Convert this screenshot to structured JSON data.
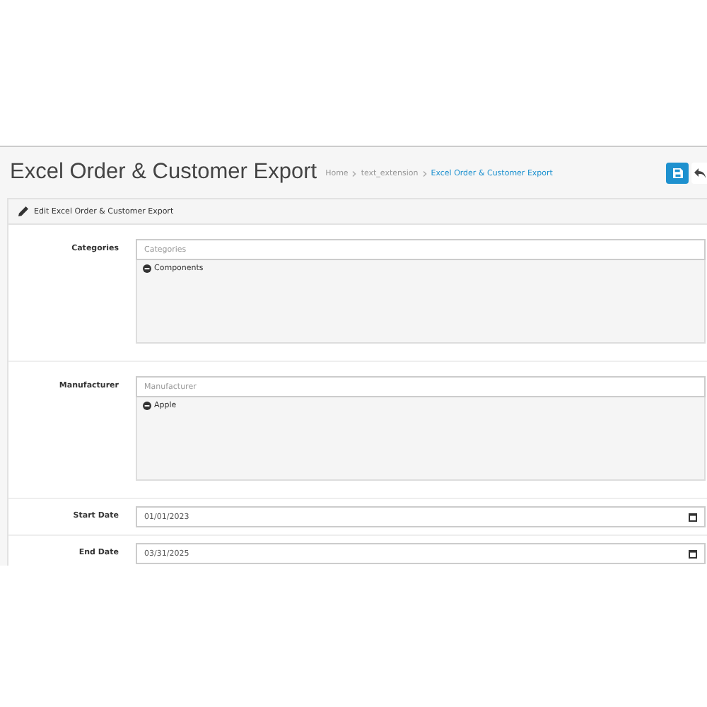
{
  "page_header": {
    "title": "Excel Order & Customer Export",
    "breadcrumbs": [
      {
        "label": "Home",
        "selected": false
      },
      {
        "label": "text_extension",
        "selected": false
      },
      {
        "label": "Excel Order & Customer Export",
        "selected": true
      }
    ]
  },
  "panel": {
    "title": "Edit Excel Order & Customer Export",
    "fields": [
      {
        "kind": "autocomplete",
        "label": "Categories",
        "placeholder": "Categories",
        "items": [
          "Components"
        ]
      },
      {
        "kind": "autocomplete",
        "label": "Manufacturer",
        "placeholder": "Manufacturer",
        "items": [
          "Apple"
        ]
      },
      {
        "kind": "date",
        "label": "Start Date",
        "value": "01/01/2023"
      },
      {
        "kind": "date",
        "label": "End Date",
        "value": "03/31/2025"
      }
    ]
  }
}
